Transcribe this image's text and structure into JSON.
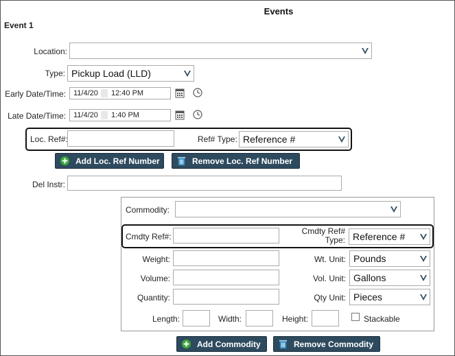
{
  "page": {
    "title": "Events",
    "event_title": "Event 1"
  },
  "colors": {
    "button_bg": "#2e4a5e",
    "add_icon": "#3aa63a",
    "remove_icon": "#3a8fc7",
    "arrow": "#2e4a5e"
  },
  "location": {
    "label": "Location:",
    "value": ""
  },
  "type": {
    "label": "Type:",
    "value": "Pickup Load (LLD)"
  },
  "early": {
    "label": "Early Date/Time:",
    "date": "11/4/20",
    "time": "12:40 PM"
  },
  "late": {
    "label": "Late Date/Time:",
    "date": "11/4/20",
    "time": "1:40 PM"
  },
  "loc_ref": {
    "label": "Loc. Ref#:",
    "value": "",
    "type_label": "Ref# Type:",
    "type_value": "Reference #"
  },
  "buttons": {
    "add_loc": "Add Loc. Ref Number",
    "remove_loc": "Remove Loc. Ref Number",
    "add_commodity": "Add Commodity",
    "remove_commodity": "Remove Commodity"
  },
  "del_instr": {
    "label": "Del Instr:",
    "value": ""
  },
  "commodity": {
    "label": "Commodity:",
    "value": "",
    "ref_label": "Cmdty Ref#:",
    "ref_value": "",
    "ref_type_label_1": "Cmdty Ref#",
    "ref_type_label_2": "Type:",
    "ref_type_value": "Reference #",
    "weight_label": "Weight:",
    "volume_label": "Volume:",
    "quantity_label": "Quantity:",
    "wt_unit_label": "Wt. Unit:",
    "wt_unit_value": "Pounds",
    "vol_unit_label": "Vol. Unit:",
    "vol_unit_value": "Gallons",
    "qty_unit_label": "Qty Unit:",
    "qty_unit_value": "Pieces",
    "length_label": "Length:",
    "width_label": "Width:",
    "height_label": "Height:",
    "stackable_label": "Stackable",
    "stackable_checked": false
  }
}
